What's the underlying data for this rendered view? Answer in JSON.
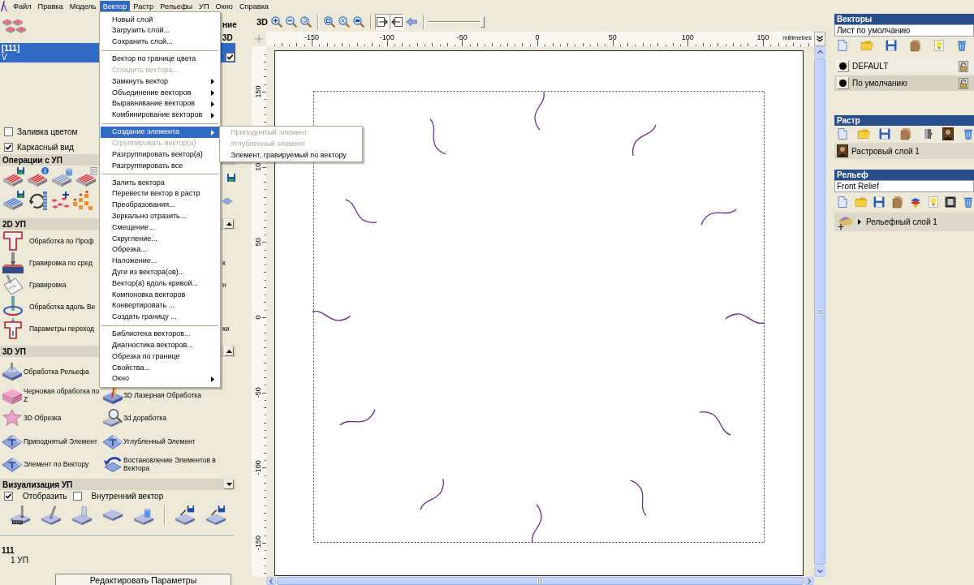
{
  "menu_bar": {
    "items": [
      {
        "label": "Файл",
        "selected": false
      },
      {
        "label": "Правка",
        "selected": false
      },
      {
        "label": "Модель",
        "selected": false
      },
      {
        "label": "Вектор",
        "selected": true
      },
      {
        "label": "Растр",
        "selected": false
      },
      {
        "label": "Рельефы",
        "selected": false
      },
      {
        "label": "УП",
        "selected": false
      },
      {
        "label": "Окно",
        "selected": false
      },
      {
        "label": "Справка",
        "selected": false
      }
    ]
  },
  "vector_menu": {
    "items": [
      {
        "kind": "item",
        "label": "Новый слой",
        "disabled": false,
        "selected": false,
        "has_submenu": false
      },
      {
        "kind": "item",
        "label": "Загрузить слой...",
        "disabled": false,
        "selected": false,
        "has_submenu": false
      },
      {
        "kind": "item",
        "label": "Сохранить слой...",
        "disabled": false,
        "selected": false,
        "has_submenu": false
      },
      {
        "kind": "separator"
      },
      {
        "kind": "item",
        "label": "Вектор по границе цвета",
        "disabled": false,
        "selected": false,
        "has_submenu": false
      },
      {
        "kind": "item",
        "label": "Сгладить вектора...",
        "disabled": true,
        "selected": false,
        "has_submenu": false
      },
      {
        "kind": "item",
        "label": "Замкнуть вектор",
        "disabled": false,
        "selected": false,
        "has_submenu": true
      },
      {
        "kind": "item",
        "label": "Объединение векторов",
        "disabled": false,
        "selected": false,
        "has_submenu": true
      },
      {
        "kind": "item",
        "label": "Выравнивание векторов",
        "disabled": false,
        "selected": false,
        "has_submenu": true
      },
      {
        "kind": "item",
        "label": "Комбинирование векторов",
        "disabled": false,
        "selected": false,
        "has_submenu": true
      },
      {
        "kind": "separator"
      },
      {
        "kind": "item",
        "label": "Создание элемента",
        "disabled": false,
        "selected": true,
        "has_submenu": true
      },
      {
        "kind": "item",
        "label": "Сгруппировать вектор(а)",
        "disabled": true,
        "selected": false,
        "has_submenu": false
      },
      {
        "kind": "item",
        "label": "Разгруппировать вектор(а)",
        "disabled": false,
        "selected": false,
        "has_submenu": false
      },
      {
        "kind": "item",
        "label": "Разгруппировать все",
        "disabled": false,
        "selected": false,
        "has_submenu": false
      },
      {
        "kind": "separator"
      },
      {
        "kind": "item",
        "label": "Залить вектора",
        "disabled": false,
        "selected": false,
        "has_submenu": false
      },
      {
        "kind": "item",
        "label": "Перевести вектор в растр",
        "disabled": false,
        "selected": false,
        "has_submenu": false
      },
      {
        "kind": "item",
        "label": "Преобразования...",
        "disabled": false,
        "selected": false,
        "has_submenu": false
      },
      {
        "kind": "item",
        "label": "Зеркально отразить...",
        "disabled": false,
        "selected": false,
        "has_submenu": false
      },
      {
        "kind": "item",
        "label": "Смещение...",
        "disabled": false,
        "selected": false,
        "has_submenu": false
      },
      {
        "kind": "item",
        "label": "Скругление...",
        "disabled": false,
        "selected": false,
        "has_submenu": false
      },
      {
        "kind": "item",
        "label": "Обрезка...",
        "disabled": false,
        "selected": false,
        "has_submenu": false
      },
      {
        "kind": "item",
        "label": "Наложение...",
        "disabled": false,
        "selected": false,
        "has_submenu": false
      },
      {
        "kind": "item",
        "label": "Дуги из вектора(ов)...",
        "disabled": false,
        "selected": false,
        "has_submenu": false
      },
      {
        "kind": "item",
        "label": "Вектор(а) вдоль кривой...",
        "disabled": false,
        "selected": false,
        "has_submenu": false
      },
      {
        "kind": "item",
        "label": "Компоновка векторов",
        "disabled": false,
        "selected": false,
        "has_submenu": false
      },
      {
        "kind": "item",
        "label": "Конвертировать ...",
        "disabled": false,
        "selected": false,
        "has_submenu": false
      },
      {
        "kind": "item",
        "label": "Создать границу ...",
        "disabled": false,
        "selected": false,
        "has_submenu": false
      },
      {
        "kind": "separator"
      },
      {
        "kind": "item",
        "label": "Библиотека векторов...",
        "disabled": false,
        "selected": false,
        "has_submenu": false
      },
      {
        "kind": "item",
        "label": "Диагностика векторов...",
        "disabled": false,
        "selected": false,
        "has_submenu": false
      },
      {
        "kind": "item",
        "label": "Обрезка по границе",
        "disabled": false,
        "selected": false,
        "has_submenu": false
      },
      {
        "kind": "item",
        "label": "Свойства...",
        "disabled": false,
        "selected": false,
        "has_submenu": false
      },
      {
        "kind": "item",
        "label": "Окно",
        "disabled": false,
        "selected": false,
        "has_submenu": true
      }
    ]
  },
  "create_feature_submenu": {
    "items": [
      {
        "label": "Приподнятый элемент",
        "disabled": true,
        "selected": false
      },
      {
        "label": "Углубленный элемент",
        "disabled": true,
        "selected": false
      },
      {
        "label": "Элемент, гравируемый по вектору",
        "disabled": false,
        "selected": false
      }
    ]
  },
  "left_panel": {
    "layer_list": {
      "column_headers": [
        "ние",
        "3D"
      ],
      "rows": [
        {
          "name": "[111]",
          "type": "V",
          "selected": true,
          "checked": true
        }
      ]
    },
    "display_options": [
      {
        "label": "Заливка цветом",
        "checked": false
      },
      {
        "label": "Каркасный вид",
        "checked": true
      }
    ],
    "operations": {
      "title": "Операции с УП"
    },
    "toolpaths_2d": {
      "title": "2D УП",
      "expanded": true,
      "items": [
        {
          "label": "Обработка по Проф"
        },
        {
          "label": "Гравировка по сред",
          "tail": "к"
        },
        {
          "label": "Гравировка",
          "tail": "н"
        },
        {
          "label": "Обработка вдоль Ве"
        },
        {
          "label": "Параметры переход",
          "tail": "ки"
        }
      ]
    },
    "toolpaths_3d": {
      "title": "3D УП",
      "expanded": true,
      "rows": [
        [
          "Обработка Рельефа"
        ],
        [
          "Черновая обработка по Z",
          "3D Лазерная Обработка"
        ],
        [
          "3D Обрезка",
          "3d доработка"
        ],
        [
          "Приподнятый Элемент",
          "Углубленный Элемент"
        ],
        [
          "Элемент по Вектору",
          "Востановление Элементов в Вектора"
        ]
      ]
    },
    "visualization": {
      "title": "Визуализация УП",
      "expanded": false,
      "options": [
        {
          "label": "Отобразить",
          "checked": true
        },
        {
          "label": "Внутренний вектор",
          "checked": false
        }
      ]
    },
    "toolpath_group": {
      "name": "111",
      "items": [
        "1 УП"
      ]
    },
    "edit_button": "Редактировать Параметры"
  },
  "canvas": {
    "toolbar": {
      "view_3d": "3D",
      "toggles": [
        {
          "pressed": true
        },
        {
          "pressed": true
        },
        {
          "pressed": false
        }
      ],
      "zoom_slider": {
        "level": 1
      }
    },
    "ruler_x": {
      "labels": [
        "-150",
        "-100",
        "-50",
        "0",
        "50",
        "100",
        "150"
      ],
      "unit": "millimetres"
    },
    "ruler_y": {
      "labels": [
        "150",
        "10",
        "50",
        "0",
        "-50",
        "-100",
        "-150"
      ]
    }
  },
  "right_panel": {
    "vectors": {
      "title": "Векторы",
      "sheet": "Лист по умолчанию",
      "layers": [
        {
          "name": "DEFAULT",
          "selected": false
        },
        {
          "name": "По умолчанию",
          "selected": true
        }
      ]
    },
    "raster": {
      "title": "Растр",
      "layers": [
        {
          "name": "Растровый слой 1"
        }
      ]
    },
    "relief": {
      "title": "Рельеф",
      "name": "Front Relief",
      "layers": [
        {
          "name": "Рельефный слой 1",
          "expanded": false
        }
      ]
    }
  }
}
